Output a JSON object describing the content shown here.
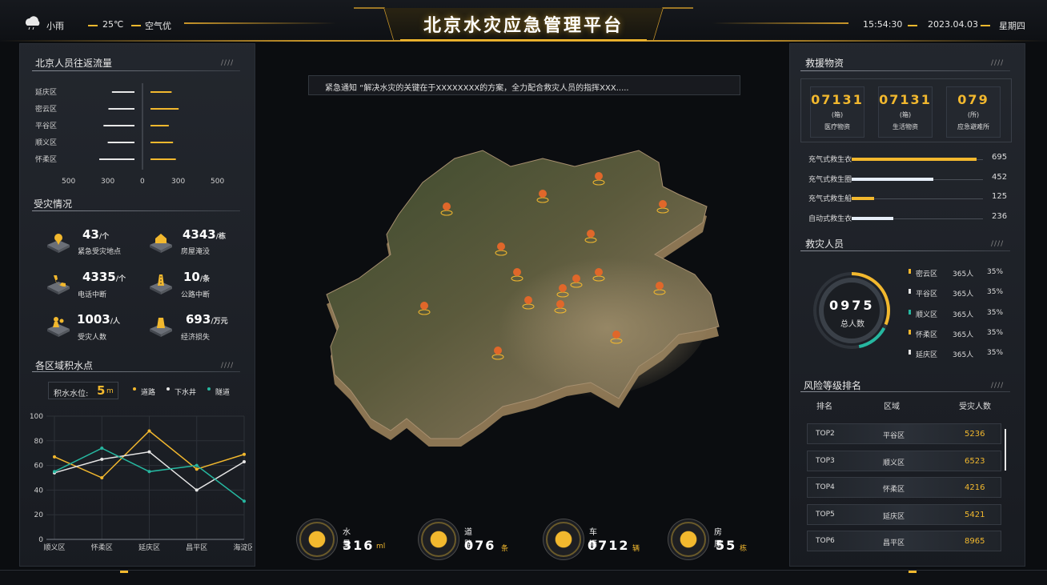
{
  "header": {
    "title": "北京水灾应急管理平台",
    "weather": "小雨",
    "temperature": "25℃",
    "air": "空气优",
    "time": "15:54:30",
    "date": "2023.04.03",
    "weekday": "星期四"
  },
  "notice": "紧急通知 “解决水灾的关键在于XXXXXXXX的方案，全力配合救灾人员的指挥XXX.....",
  "flow": {
    "title": "北京人员往返流量",
    "mark": "////",
    "districts": [
      "延庆区",
      "密云区",
      "平谷区",
      "顺义区",
      "怀柔区"
    ],
    "outbound": [
      160,
      185,
      220,
      190,
      250
    ],
    "inbound": [
      150,
      200,
      130,
      160,
      180
    ],
    "axis": [
      "500",
      "300",
      "0",
      "300",
      "500"
    ]
  },
  "disaster": {
    "title": "受灾情况",
    "items": [
      {
        "value": "43",
        "unit": "/个",
        "label": "紧急受灾地点",
        "icon": "location-pin-icon"
      },
      {
        "value": "4343",
        "unit": "/栋",
        "label": "房屋淹没",
        "icon": "house-icon"
      },
      {
        "value": "4335",
        "unit": "/个",
        "label": "电话中断",
        "icon": "phone-icon"
      },
      {
        "value": "10",
        "unit": "/条",
        "label": "公路中断",
        "icon": "road-icon"
      },
      {
        "value": "1003",
        "unit": "/人",
        "label": "受灾人数",
        "icon": "people-icon"
      },
      {
        "value": "693",
        "unit": "/万元",
        "label": "经济损失",
        "icon": "money-icon"
      }
    ]
  },
  "water": {
    "title": "各区域积水点",
    "mark": "////",
    "level_label": "积水水位:",
    "level_value": "5",
    "level_unit": "m",
    "legend": [
      "道路",
      "下水井",
      "隧道"
    ]
  },
  "chart_data": {
    "type": "line",
    "categories": [
      "顺义区",
      "怀柔区",
      "延庆区",
      "昌平区",
      "海淀区"
    ],
    "yticks": [
      "0",
      "20",
      "40",
      "60",
      "80",
      "100"
    ],
    "ylim": [
      0,
      100
    ],
    "series": [
      {
        "name": "道路",
        "color": "#f2b82e",
        "values": [
          67,
          50,
          88,
          57,
          69
        ]
      },
      {
        "name": "下水井",
        "color": "#e6e6e6",
        "values": [
          54,
          65,
          71,
          40,
          63
        ]
      },
      {
        "name": "隧道",
        "color": "#26b7a0",
        "values": [
          55,
          74,
          55,
          60,
          31
        ]
      }
    ]
  },
  "bottom": [
    {
      "label": "水量",
      "value": "316",
      "unit": "ml",
      "icon": "water-drop-icon"
    },
    {
      "label": "道路",
      "value": "076",
      "unit": "条",
      "icon": "road-icon"
    },
    {
      "label": "车辆",
      "value": "0712",
      "unit": "辆",
      "icon": "car-icon"
    },
    {
      "label": "房屋",
      "value": "55",
      "unit": "栋",
      "icon": "drop-house-icon"
    }
  ],
  "supplies": {
    "title": "救援物资",
    "mark": "////",
    "boxes": [
      {
        "value": "07131",
        "unit": "(箱)",
        "label": "医疗物资"
      },
      {
        "value": "07131",
        "unit": "(箱)",
        "label": "生活物资"
      },
      {
        "value": "079",
        "unit": "(所)",
        "label": "应急避难所"
      }
    ],
    "bars": [
      {
        "label": "充气式救生衣",
        "value": "695",
        "fraction": 0.95,
        "color": "#f2b82e"
      },
      {
        "label": "充气式救生圈",
        "value": "452",
        "fraction": 0.62,
        "color": "#e6eef8"
      },
      {
        "label": "充气式救生船",
        "value": "125",
        "fraction": 0.17,
        "color": "#f2b82e"
      },
      {
        "label": "自动式救生衣",
        "value": "236",
        "fraction": 0.32,
        "color": "#e6eef8"
      }
    ]
  },
  "rescuers": {
    "title": "救灾人员",
    "mark": "////",
    "total": "0975",
    "total_label": "总人数",
    "rows": [
      {
        "district": "密云区",
        "count": "365人",
        "pct": "35%",
        "color": "#f2b82e"
      },
      {
        "district": "平谷区",
        "count": "365人",
        "pct": "35%",
        "color": "#e6e6e6"
      },
      {
        "district": "顺义区",
        "count": "365人",
        "pct": "35%",
        "color": "#26b7a0"
      },
      {
        "district": "怀柔区",
        "count": "365人",
        "pct": "35%",
        "color": "#f2b82e"
      },
      {
        "district": "延庆区",
        "count": "365人",
        "pct": "35%",
        "color": "#e6e6e6"
      }
    ]
  },
  "risk": {
    "title": "风险等级排名",
    "mark": "////",
    "headers": [
      "排名",
      "区域",
      "受灾人数"
    ],
    "rows": [
      {
        "rank": "TOP2",
        "district": "平谷区",
        "count": "5236"
      },
      {
        "rank": "TOP3",
        "district": "顺义区",
        "count": "6523"
      },
      {
        "rank": "TOP4",
        "district": "怀柔区",
        "count": "4216"
      },
      {
        "rank": "TOP5",
        "district": "延庆区",
        "count": "5421"
      },
      {
        "rank": "TOP6",
        "district": "昌平区",
        "count": "8965"
      }
    ]
  }
}
